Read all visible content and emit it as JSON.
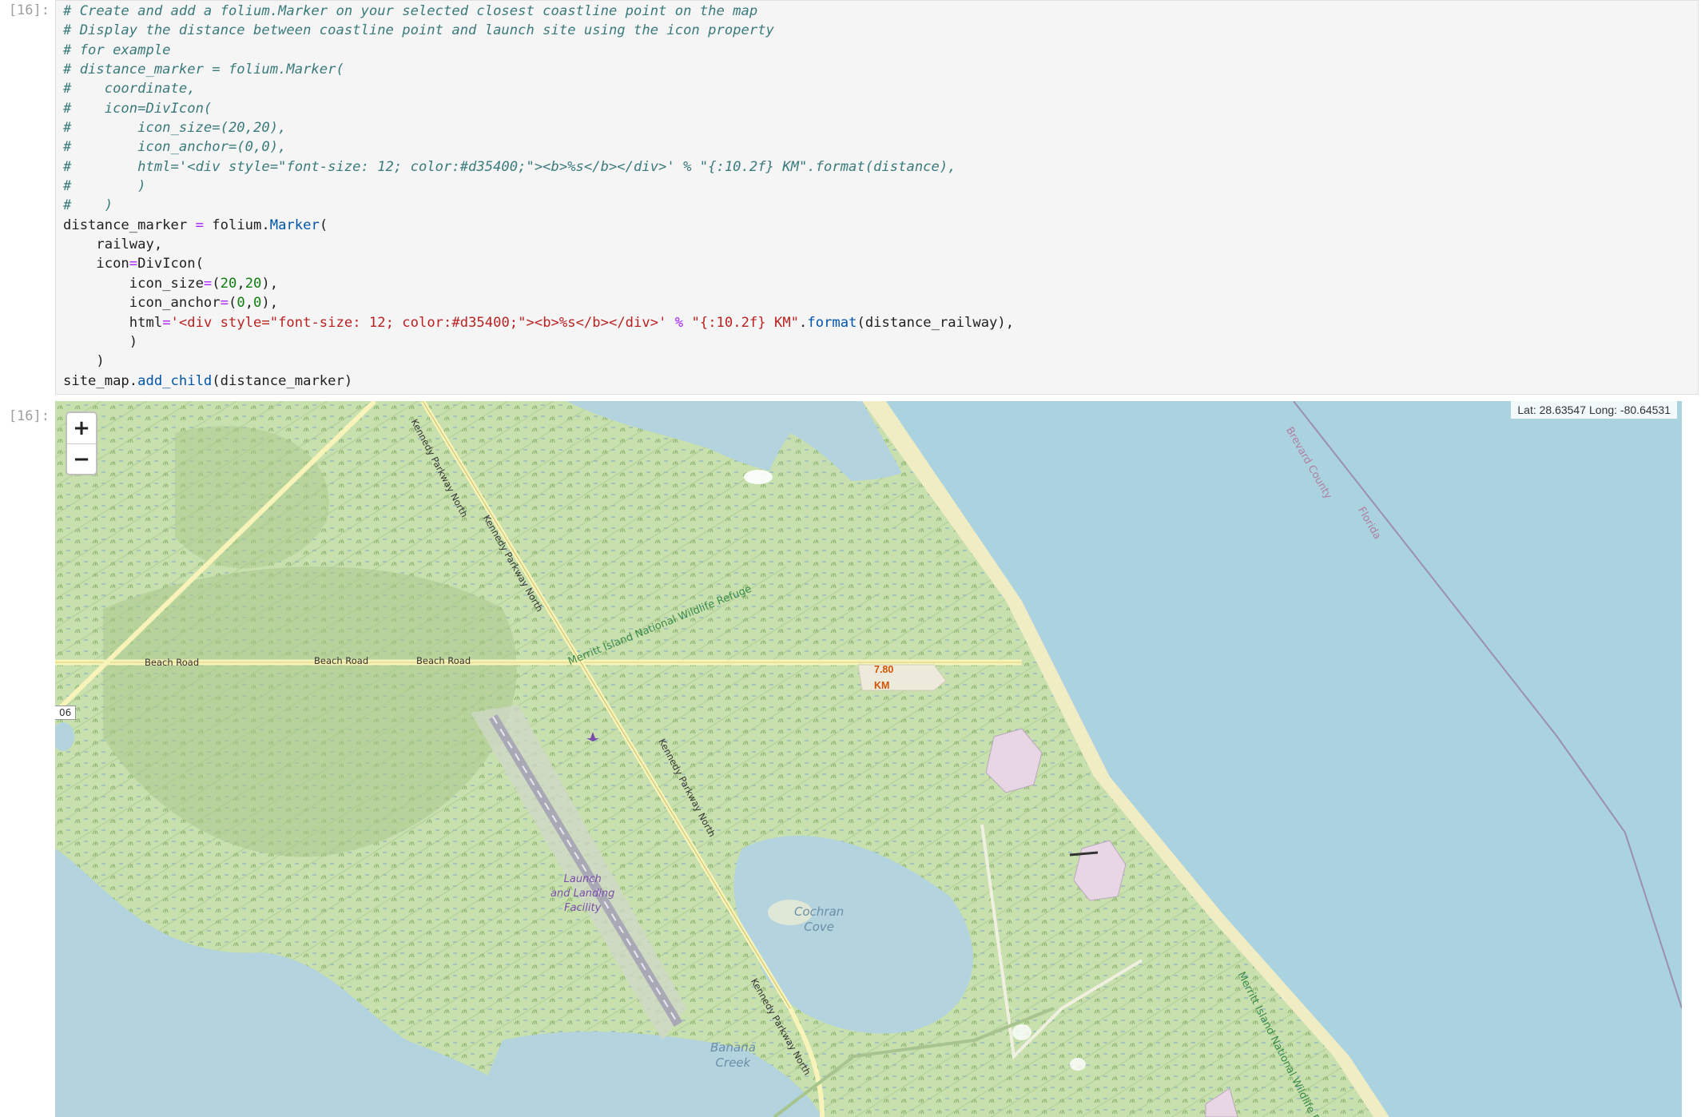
{
  "cells": {
    "input_prompt": "[16]:",
    "output_prompt": "[16]:"
  },
  "code_lines": [
    "# Create and add a folium.Marker on your selected closest coastline point on the map",
    "# Display the distance between coastline point and launch site using the icon property",
    "# for example",
    "# distance_marker = folium.Marker(",
    "#    coordinate,",
    "#    icon=DivIcon(",
    "#        icon_size=(20,20),",
    "#        icon_anchor=(0,0),",
    "#        html='<div style=\"font-size: 12; color:#d35400;\"><b>%s</b></div>' % \"{:10.2f} KM\".format(distance),",
    "#        )",
    "#    )",
    "distance_marker = folium.Marker(",
    "    railway,",
    "    icon=DivIcon(",
    "        icon_size=(20,20),",
    "        icon_anchor=(0,0),",
    "        html='<div style=\"font-size: 12; color:#d35400;\"><b>%s</b></div>' % \"{:10.2f} KM\".format(distance_railway),",
    "        )",
    "    )",
    "site_map.add_child(distance_marker)"
  ],
  "map": {
    "zoom_in": "+",
    "zoom_out": "−",
    "coords_lat": "Lat: 28.63547",
    "coords_long": "Long: -80.64531",
    "distance_label": "7.80 KM",
    "edge_badge": "06",
    "road_labels": [
      "Beach Road",
      "Beach Road",
      "Beach Road"
    ],
    "parkway_labels": [
      "Kennedy Parkway North",
      "Kennedy Parkway North",
      "Kennedy Parkway North",
      "Kennedy Parkway North"
    ],
    "refuge_label": "Merritt Island National Wildlife Refuge",
    "refuge_label_2": "Merritt Island National Wildlife Refuge",
    "facility_label": "Launch\nand Landing\nFacility",
    "cove_label": "Cochran\nCove",
    "creek_label": "Banana\nCreek",
    "county_labels": [
      "Brevard County",
      "Florida"
    ],
    "colors": {
      "water": "#b3d3de",
      "land": "#c9dfae",
      "marker_text": "#d35400"
    }
  }
}
